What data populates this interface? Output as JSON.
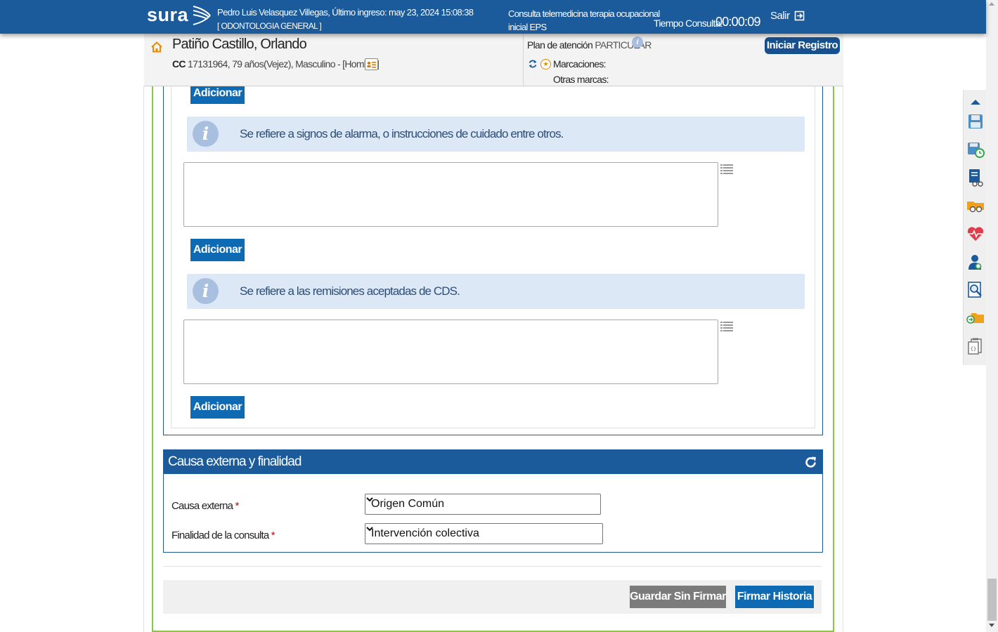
{
  "header": {
    "logo": "sura",
    "user_line1": "Pedro Luis Velasquez Villegas, Último ingreso: may 23, 2024 15:08:38",
    "user_line2": "[ ODONTOLOGIA GENERAL ]",
    "consult_line1": "Consulta telemedicina terapia ocupacional",
    "consult_line2": "inicial EPS",
    "time_label": "Tiempo Consulta:",
    "time_value": "00:00:09",
    "logout_label": "Salir"
  },
  "patient": {
    "name": "Patiño Castillo, Orlando",
    "id_type": "CC",
    "info": "17131964, 79 años(Vejez), Masculino - [Hombre]",
    "plan_label": "Plan de atención",
    "plan_value": "PARTICULAR",
    "start_button": "Iniciar Registro",
    "marks_label": "Marcaciones:",
    "other_marks_label": "Otras marcas:"
  },
  "content": {
    "add_label": "Adicionar",
    "info_1": "Se refiere a signos de alarma, o instrucciones de cuidado entre otros.",
    "info_2": "Se refiere a las remisiones aceptadas de CDS."
  },
  "section": {
    "title": "Causa externa y finalidad",
    "causa_label": "Causa externa",
    "causa_value": "Origen Común",
    "finalidad_label": "Finalidad de la consulta",
    "finalidad_value": "Intervención colectiva",
    "required_mark": "*"
  },
  "footer": {
    "save_unsigned": "Guardar Sin Firmar",
    "sign": "Firmar Historia"
  },
  "toolbar": {
    "icons": [
      "scroll-top-icon",
      "save-icon",
      "save-scheduled-icon",
      "document-review-icon",
      "glasses-folder-icon",
      "heart-pulse-icon",
      "user-search-icon",
      "zoom-document-icon",
      "folder-move-icon",
      "clipboard-copy-icon"
    ]
  },
  "colors": {
    "brand_blue": "#1b5a9b",
    "button_blue": "#0f6ab4",
    "info_bg": "#dce8f6",
    "green_border": "#8cc34a"
  }
}
